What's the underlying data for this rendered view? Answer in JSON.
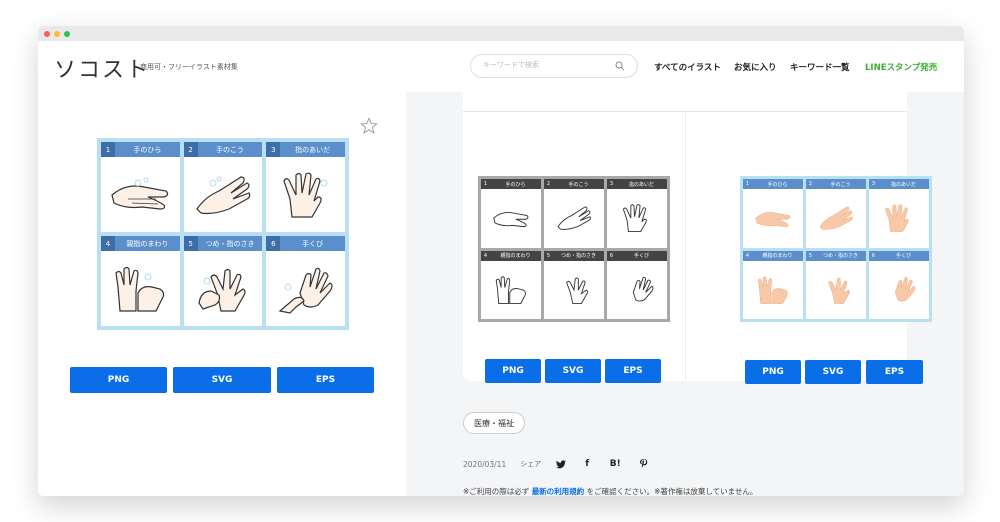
{
  "site": {
    "logo": "ソコスト",
    "tagline": "商用可・フリーイラスト素材集"
  },
  "search": {
    "placeholder": "キーワードで検索"
  },
  "nav": {
    "all": "すべてのイラスト",
    "favorites": "お気に入り",
    "keywords": "キーワード一覧",
    "line": "LINEスタンプ発売"
  },
  "main_illustration": {
    "cells": [
      {
        "num": "1",
        "title": "手のひら"
      },
      {
        "num": "2",
        "title": "手のこう"
      },
      {
        "num": "3",
        "title": "指のあいだ"
      },
      {
        "num": "4",
        "title": "親指のまわり"
      },
      {
        "num": "5",
        "title": "つめ・指のさき"
      },
      {
        "num": "6",
        "title": "手くび"
      }
    ]
  },
  "buttons": {
    "png": "PNG",
    "svg": "SVG",
    "eps": "EPS"
  },
  "tag": "医療・福祉",
  "meta": {
    "date": "2020/03/11",
    "share": "シェア",
    "social_facebook": "f",
    "social_hatena": "B!"
  },
  "notice": {
    "prefix": "※ご利用の際は必ず",
    "link": "最新の利用規約",
    "suffix": "をご確認ください。※著作権は放棄していません。"
  },
  "colors": {
    "accent": "#0a6ee8",
    "line_green": "#3cb034",
    "frame_blue": "#b9e0f2",
    "header_blue": "#5b8fcc"
  }
}
